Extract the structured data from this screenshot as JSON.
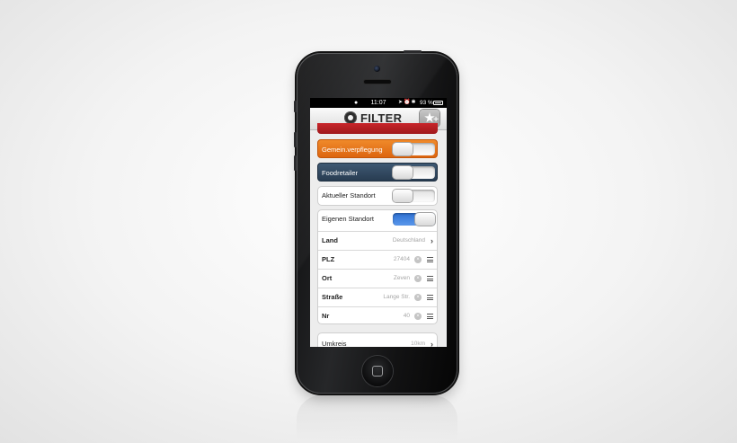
{
  "status_bar": {
    "time": "11:07",
    "battery_text": "93 %"
  },
  "header": {
    "logo_text": "FILTER",
    "favorite_icon": "star-plus-icon"
  },
  "filters": {
    "red_category": {
      "label": "",
      "enabled": false,
      "color": "#b51f23"
    },
    "gemeinverpflegung": {
      "label": "Gemein.verpflegung",
      "enabled": false,
      "color": "#eb7a1f"
    },
    "foodretailer": {
      "label": "Foodretailer",
      "enabled": false,
      "color": "#324960"
    },
    "aktueller_standort": {
      "label": "Aktueller Standort",
      "enabled": false
    },
    "eigenen_standort": {
      "label": "Eigenen Standort",
      "enabled": true,
      "color": "#3a7fe0"
    }
  },
  "location": {
    "land": {
      "label": "Land",
      "value": "Deutschland"
    },
    "plz": {
      "label": "PLZ",
      "value": "27404"
    },
    "ort": {
      "label": "Ort",
      "value": "Zeven"
    },
    "strasse": {
      "label": "Straße",
      "value": "Lange Str."
    },
    "nr": {
      "label": "Nr",
      "value": "40"
    }
  },
  "umkreis": {
    "label": "Umkreis",
    "value": "10km"
  }
}
